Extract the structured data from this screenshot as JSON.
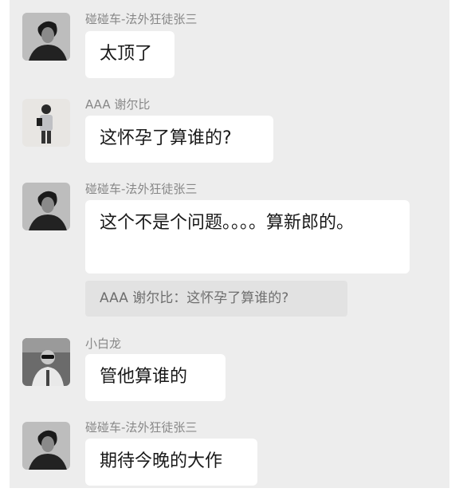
{
  "messages": [
    {
      "sender": "碰碰车-法外狂徒张三",
      "text": "太顶了",
      "avatar_icon": "man-portrait-avatar-icon"
    },
    {
      "sender": "AAA 谢尔比",
      "text": "这怀孕了算谁的?",
      "avatar_icon": "man-full-body-avatar-icon"
    },
    {
      "sender": "碰碰车-法外狂徒张三",
      "text": "这个不是个问题。。。。算新郎的。",
      "quote": "AAA 谢尔比：这怀孕了算谁的?",
      "avatar_icon": "man-portrait-avatar-icon"
    },
    {
      "sender": "小白龙",
      "text": "管他算谁的",
      "avatar_icon": "man-sunglasses-avatar-icon"
    },
    {
      "sender": "碰碰车-法外狂徒张三",
      "text": "期待今晚的大作",
      "avatar_icon": "man-portrait-avatar-icon"
    }
  ],
  "colors": {
    "background": "#ededed",
    "bubble": "#ffffff",
    "quote": "#e2e2e2",
    "sender": "#888888",
    "text": "#191919"
  }
}
